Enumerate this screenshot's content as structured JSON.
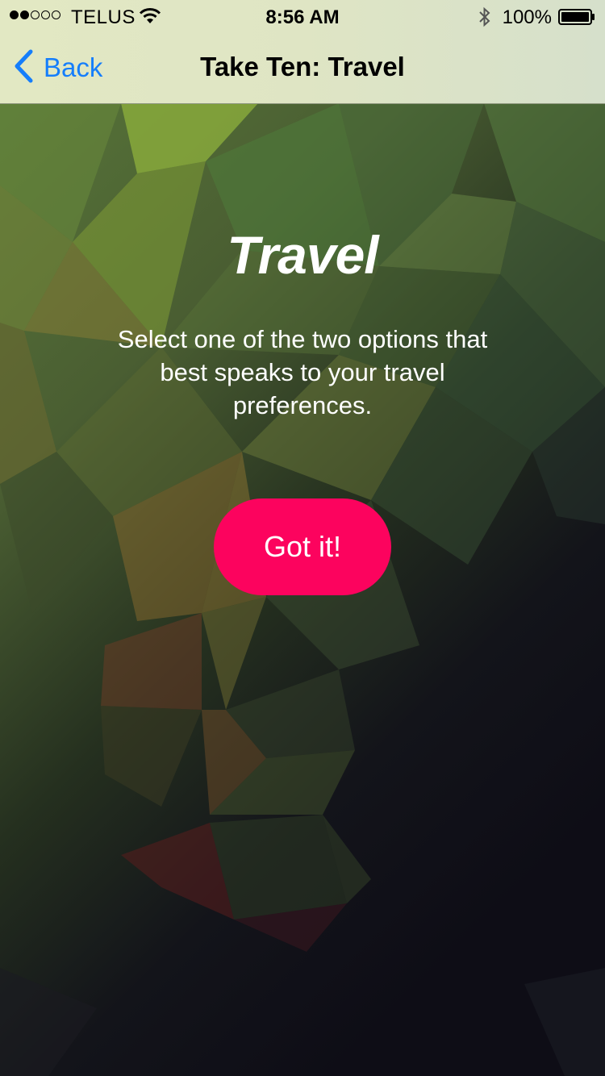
{
  "status_bar": {
    "signal_dots_filled": 2,
    "signal_dots_total": 5,
    "carrier": "TELUS",
    "time": "8:56 AM",
    "battery_percent": "100%",
    "battery_level": 1.0,
    "icons": [
      "wifi-icon",
      "bluetooth-icon",
      "battery-icon"
    ]
  },
  "nav": {
    "back_label": "Back",
    "back_icon": "chevron-left-icon",
    "title": "Take Ten: Travel"
  },
  "content": {
    "heading": "Travel",
    "description": "Select one of the two options that best speaks to your travel preferences.",
    "button_label": "Got it!"
  },
  "colors": {
    "accent_blue": "#157efb",
    "button_pink": "#fc035e",
    "bar_background": "#e0e6c4",
    "background_dark": "#0e0d16"
  }
}
